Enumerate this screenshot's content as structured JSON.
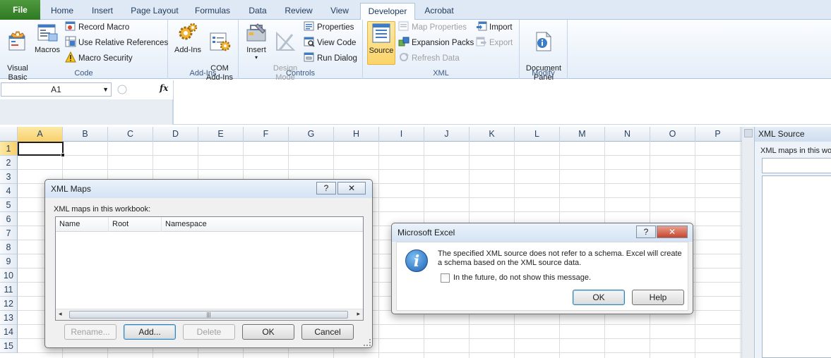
{
  "tabs": [
    {
      "label": "File"
    },
    {
      "label": "Home"
    },
    {
      "label": "Insert"
    },
    {
      "label": "Page Layout"
    },
    {
      "label": "Formulas"
    },
    {
      "label": "Data"
    },
    {
      "label": "Review"
    },
    {
      "label": "View"
    },
    {
      "label": "Developer"
    },
    {
      "label": "Acrobat"
    }
  ],
  "active_tab": "Developer",
  "ribbon": {
    "code": {
      "label": "Code",
      "visual_basic": "Visual\nBasic",
      "macros": "Macros",
      "record_macro": "Record Macro",
      "use_relative_references": "Use Relative References",
      "macro_security": "Macro Security"
    },
    "addins": {
      "label": "Add-Ins",
      "addins": "Add-Ins",
      "com_addins": "COM\nAdd-Ins"
    },
    "controls": {
      "label": "Controls",
      "insert": "Insert",
      "design_mode": "Design\nMode",
      "properties": "Properties",
      "view_code": "View Code",
      "run_dialog": "Run Dialog"
    },
    "xml": {
      "label": "XML",
      "source": "Source",
      "map_properties": "Map Properties",
      "expansion_packs": "Expansion Packs",
      "refresh_data": "Refresh Data",
      "import": "Import",
      "export": "Export"
    },
    "modify": {
      "label": "Modify",
      "document_panel": "Document\nPanel"
    }
  },
  "formula_bar": {
    "name_box": "A1",
    "fx": "fx"
  },
  "columns": [
    "A",
    "B",
    "C",
    "D",
    "E",
    "F",
    "G",
    "H",
    "I",
    "J",
    "K",
    "L",
    "M",
    "N",
    "O",
    "P"
  ],
  "rows": [
    "1",
    "2",
    "3",
    "4",
    "5",
    "6",
    "7",
    "8",
    "9",
    "10",
    "11",
    "12",
    "13",
    "14",
    "15"
  ],
  "xml_source_pane": {
    "title": "XML Source",
    "maps_label": "XML maps in this workbook:"
  },
  "xml_maps_dialog": {
    "title": "XML Maps",
    "help": "?",
    "close": "✕",
    "list_label": "XML maps in this workbook:",
    "columns": [
      "Name",
      "Root",
      "Namespace"
    ],
    "buttons": {
      "rename": "Rename...",
      "add": "Add...",
      "delete": "Delete",
      "ok": "OK",
      "cancel": "Cancel"
    }
  },
  "excel_dialog": {
    "title": "Microsoft Excel",
    "help": "?",
    "close": "✕",
    "message": "The specified XML source does not refer to a schema. Excel will create a schema based on the XML source data.",
    "checkbox_label": "In the future, do not show this message.",
    "ok": "OK",
    "help_button": "Help"
  },
  "colors": {
    "file_tab": "#2e7a22",
    "ribbon_bg": "#dfe9f5",
    "selection_highlight": "#f8cf6b",
    "grid_line": "#dadcdd"
  }
}
